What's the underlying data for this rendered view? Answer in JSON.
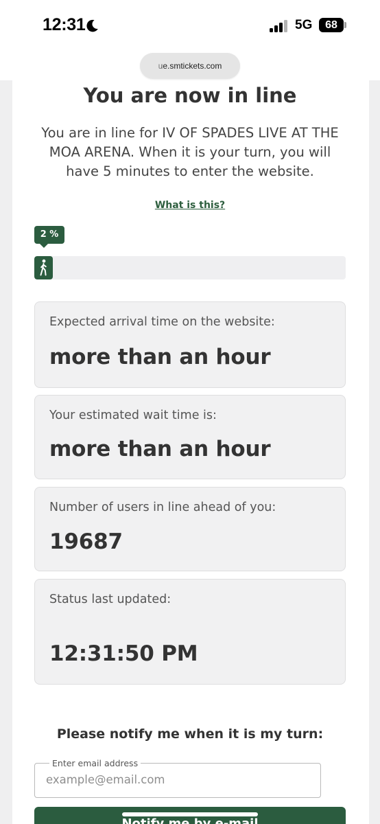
{
  "status_bar": {
    "time": "12:31",
    "moon_icon": "moon-icon",
    "signal_bars": 3,
    "network": "5G",
    "battery": "68"
  },
  "browser": {
    "url": "ue.smtickets.com"
  },
  "queue": {
    "title": "You are now in line",
    "description": "You are in line for IV OF SPADES LIVE AT THE MOA ARENA. When it is your turn, you will have 5 minutes to enter the website.",
    "what_is_this": "What is this?",
    "progress_label": "2 %",
    "progress_percent": 2,
    "progress_icon": "walking-person-icon"
  },
  "info_boxes": [
    {
      "label": "Expected arrival time on the website:",
      "value": "more than an hour"
    },
    {
      "label": "Your estimated wait time is:",
      "value": "more than an hour"
    },
    {
      "label": "Number of users in line ahead of you:",
      "value": "19687"
    },
    {
      "label": "Status last updated:",
      "value": "12:31:50 PM"
    }
  ],
  "notify": {
    "heading": "Please notify me when it is my turn:",
    "email_label": "Enter email address",
    "email_placeholder": "example@email.com",
    "button_label": "Notify me by e-mail"
  },
  "colors": {
    "accent": "#2b5c3f",
    "box_background": "#f1f1f2",
    "text": "#333333"
  }
}
